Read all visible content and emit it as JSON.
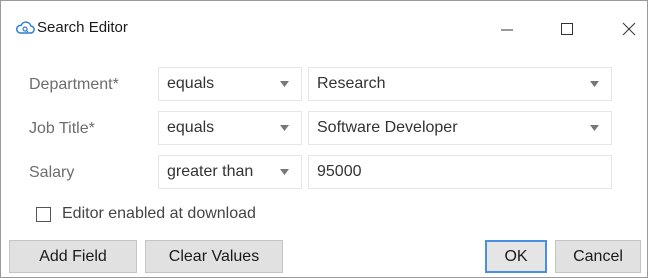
{
  "window": {
    "title": "Search Editor",
    "icon": "cloud-search-icon",
    "controls": [
      "minimize-icon",
      "maximize-icon",
      "close-icon"
    ]
  },
  "rows": [
    {
      "label": "Department*",
      "operator": "equals",
      "value": "Research",
      "value_type": "dropdown"
    },
    {
      "label": "Job Title*",
      "operator": "equals",
      "value": "Software Developer",
      "value_type": "dropdown"
    },
    {
      "label": "Salary",
      "operator": "greater than",
      "value": "95000",
      "value_type": "text"
    }
  ],
  "options": {
    "editor_enabled_label": "Editor enabled at download",
    "editor_enabled_checked": false
  },
  "buttons": {
    "add_field": "Add Field",
    "clear_values": "Clear Values",
    "ok": "OK",
    "cancel": "Cancel"
  },
  "colors": {
    "ok_border": "#4a90e2",
    "label_text": "#6d6d6d",
    "icon_accent": "#2f7fd3"
  }
}
